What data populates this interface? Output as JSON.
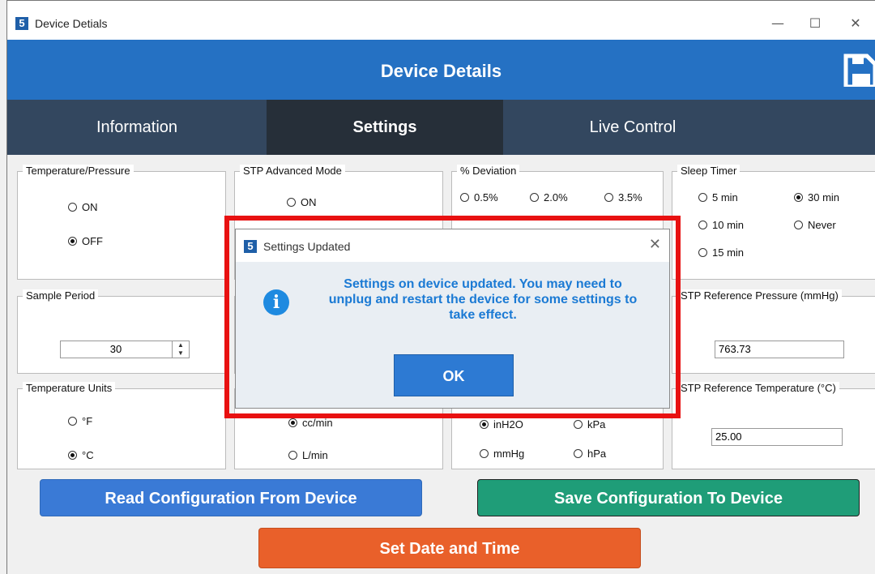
{
  "window": {
    "title": "Device Detials",
    "minimize": "—",
    "maximize": "☐",
    "close": "✕"
  },
  "header": {
    "title": "Device  Details"
  },
  "tabs": [
    {
      "label": "Information"
    },
    {
      "label": "Settings"
    },
    {
      "label": "Live Control"
    }
  ],
  "temperature_pressure": {
    "label": "Temperature/Pressure",
    "on": "ON",
    "off": "OFF",
    "selected": "OFF"
  },
  "stp_advanced": {
    "label": "STP Advanced Mode",
    "on": "ON"
  },
  "deviation": {
    "label": "% Deviation",
    "options": [
      "0.5%",
      "2.0%",
      "3.5%"
    ]
  },
  "sleep_timer": {
    "label": "Sleep Timer",
    "options": [
      "5 min",
      "30 min",
      "10 min",
      "Never",
      "15 min"
    ],
    "selected": "30 min"
  },
  "sample_period": {
    "label": "Sample Period",
    "value": "30"
  },
  "stp_ref_pressure": {
    "label": "STP Reference Pressure (mmHg)",
    "value": "763.73"
  },
  "temperature_units": {
    "label": "Temperature Units",
    "f": "°F",
    "c": "°C",
    "selected": "°C"
  },
  "flow_units": {
    "cc": "cc/min",
    "l": "L/min",
    "selected": "cc/min"
  },
  "pressure_units": {
    "options": [
      "inH2O",
      "kPa",
      "mmHg",
      "hPa"
    ],
    "selected": "inH2O"
  },
  "stp_ref_temp": {
    "label": "STP Reference Temperature (°C)",
    "value": "25.00"
  },
  "buttons": {
    "read": "Read Configuration From Device",
    "save": "Save Configuration To Device",
    "datetime": "Set Date and Time"
  },
  "dialog": {
    "title": "Settings Updated",
    "message": "Settings on device updated. You may need to unplug and restart the device for some settings to take effect.",
    "ok": "OK"
  },
  "colors": {
    "header": "#2571c3",
    "tabs": "#33475f",
    "read_btn": "#3a7ad6",
    "save_btn": "#1f9d78",
    "datetime_btn": "#e9602a",
    "highlight": "#e81111"
  }
}
